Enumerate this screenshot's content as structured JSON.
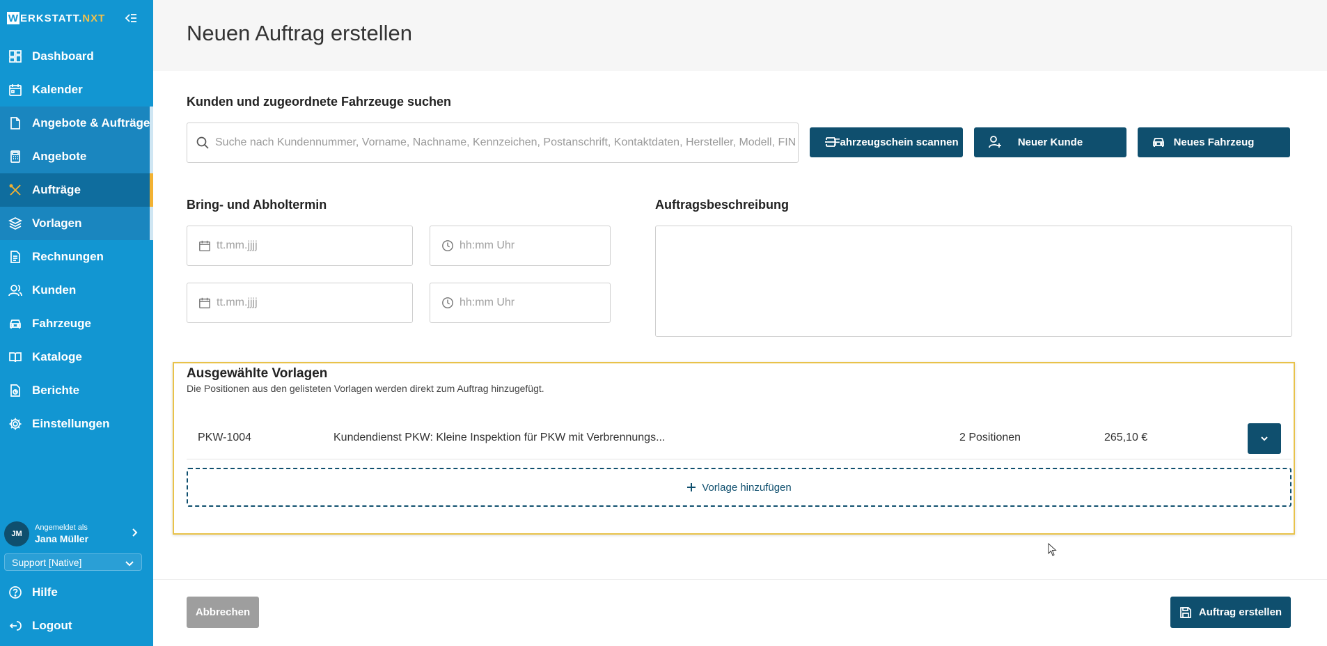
{
  "app": {
    "logo_letter": "W",
    "logo_text": "ERKSTATT.",
    "logo_suffix": "NXT"
  },
  "sidebar": {
    "items": [
      {
        "label": "Dashboard",
        "icon": "dashboard-icon"
      },
      {
        "label": "Kalender",
        "icon": "calendar-icon"
      },
      {
        "label": "Angebote & Aufträge",
        "icon": "document-icon"
      },
      {
        "label": "Angebote",
        "icon": "calculator-icon"
      },
      {
        "label": "Aufträge",
        "icon": "tools-icon"
      },
      {
        "label": "Vorlagen",
        "icon": "layers-icon"
      },
      {
        "label": "Rechnungen",
        "icon": "invoice-icon"
      },
      {
        "label": "Kunden",
        "icon": "users-icon"
      },
      {
        "label": "Fahrzeuge",
        "icon": "car-icon"
      },
      {
        "label": "Kataloge",
        "icon": "book-icon"
      },
      {
        "label": "Berichte",
        "icon": "report-icon"
      },
      {
        "label": "Einstellungen",
        "icon": "gear-icon"
      }
    ],
    "user": {
      "initials": "JM",
      "caption": "Angemeldet als",
      "name": "Jana Müller"
    },
    "support": "Support [Native]",
    "bottom": [
      {
        "label": "Hilfe",
        "icon": "help-icon"
      },
      {
        "label": "Logout",
        "icon": "logout-icon"
      }
    ],
    "accent": "#f2b233",
    "background": "#1296d2"
  },
  "page": {
    "title": "Neuen Auftrag erstellen"
  },
  "customer_search": {
    "label": "Kunden und zugeordnete Fahrzeuge suchen",
    "placeholder": "Suche nach Kundennummer, Vorname, Nachname, Kennzeichen, Postanschrift, Kontaktdaten, Hersteller, Modell, FIN",
    "scan_button": "Fahrzeugschein scannen",
    "new_customer_button": "Neuer Kunde",
    "new_vehicle_button": "Neues Fahrzeug"
  },
  "appointment": {
    "label": "Bring- und Abholtermin",
    "date_placeholder": "tt.mm.jjjj",
    "time_placeholder": "hh:mm Uhr"
  },
  "description": {
    "label": "Auftragsbeschreibung",
    "value": ""
  },
  "templates": {
    "title": "Ausgewählte Vorlagen",
    "subtitle": "Die Positionen aus den gelisteten Vorlagen werden direkt zum Auftrag hinzugefügt.",
    "rows": [
      {
        "code": "PKW-1004",
        "description": "Kundendienst PKW: Kleine Inspektion für PKW mit Verbrennungs...",
        "positions": "2 Positionen",
        "price": "265,10 €"
      }
    ],
    "add_label": "Vorlage hinzufügen",
    "highlight_color": "#e8c24a"
  },
  "footer": {
    "cancel_label": "Abbrechen",
    "create_label": "Auftrag erstellen"
  },
  "colors": {
    "primary_dark": "#0f4f6e",
    "cancel_gray": "#9e9e9e"
  }
}
